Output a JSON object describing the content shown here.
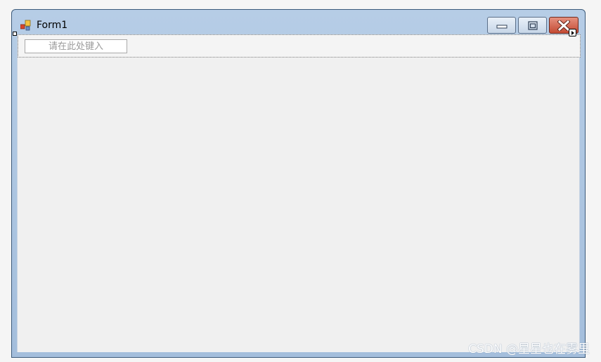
{
  "window": {
    "title": "Form1",
    "controls": {
      "minimize_icon": "minimize-icon",
      "maximize_icon": "maximize-icon",
      "close_icon": "close-icon"
    }
  },
  "menu_strip": {
    "placeholder": "请在此处键入"
  },
  "watermark": {
    "text": "CSDN @星星也在雾里"
  },
  "colors": {
    "titlebar": "#a4bedc",
    "close_button": "#c44a33",
    "client_background": "#f0f0f0"
  }
}
